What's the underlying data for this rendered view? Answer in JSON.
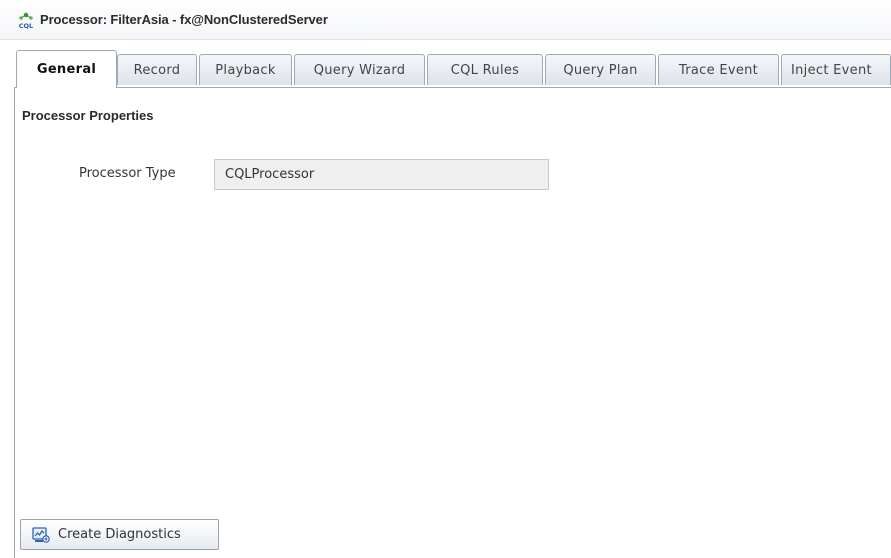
{
  "window": {
    "icon": "cql-processor-icon",
    "title": "Processor: FilterAsia - fx@NonClusteredServer"
  },
  "tabs": [
    {
      "label": "General",
      "active": true
    },
    {
      "label": "Record",
      "active": false
    },
    {
      "label": "Playback",
      "active": false
    },
    {
      "label": "Query Wizard",
      "active": false
    },
    {
      "label": "CQL Rules",
      "active": false
    },
    {
      "label": "Query Plan",
      "active": false
    },
    {
      "label": "Trace Event",
      "active": false
    },
    {
      "label": "Inject Event",
      "active": false
    }
  ],
  "general": {
    "section_title": "Processor Properties",
    "processor_type_label": "Processor Type",
    "processor_type_value": "CQLProcessor"
  },
  "actions": {
    "create_diagnostics_label": "Create Diagnostics",
    "create_diagnostics_icon": "diagnostics-icon"
  },
  "colors": {
    "tab_border": "#9fa9b5",
    "input_background": "#efefef"
  }
}
